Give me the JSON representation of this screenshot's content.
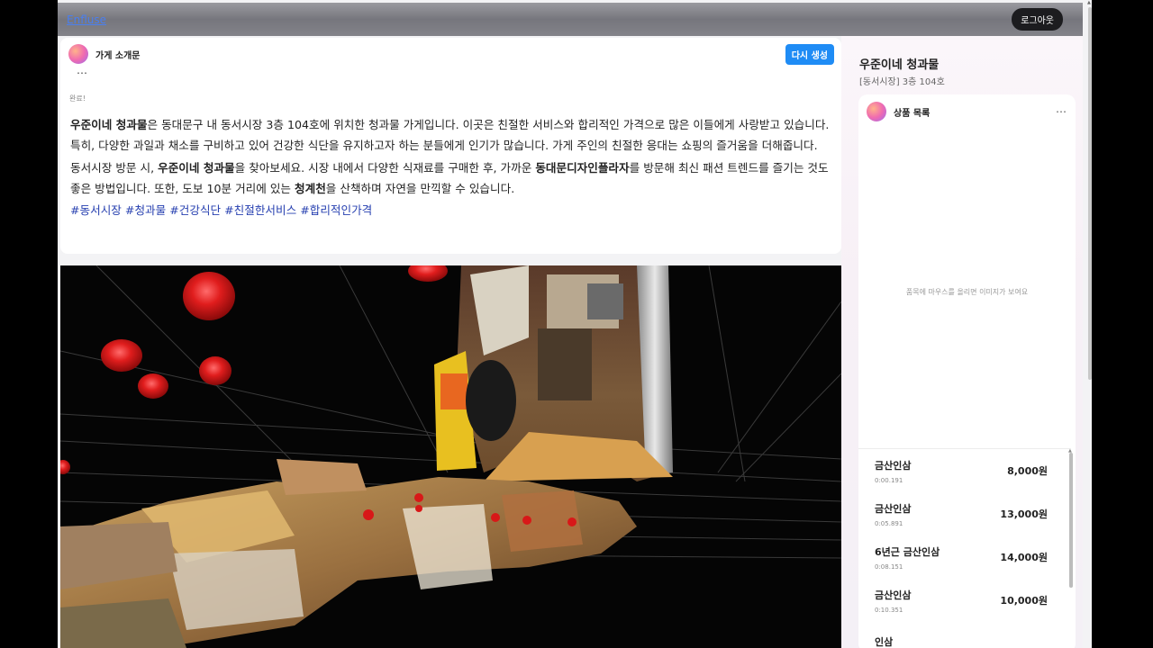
{
  "topbar": {
    "brand": "Enfluse",
    "logout_label": "로그아웃"
  },
  "intro": {
    "title": "가게 소개문",
    "regenerate_label": "다시 생성",
    "more": "⋯",
    "status": "완료!",
    "p1": [
      {
        "text": "우준이네 청과물",
        "bold": true
      },
      {
        "text": "은 동대문구 내 동서시장 3층 104호에 위치한 청과물 가게입니다. 이곳은 친절한 서비스와 합리적인 가격으로 많은 이들에게 사랑받고 있습니다. 특히, 다양한 과일과 채소를 구비하고 있어 건강한 식단을 유지하고자 하는 분들에게 인기가 많습니다. 가게 주인의 친절한 응대는 쇼핑의 즐거움을 더해줍니다.",
        "bold": false
      }
    ],
    "p2": [
      {
        "text": "동서시장 방문 시, ",
        "bold": false
      },
      {
        "text": "우준이네 청과물",
        "bold": true
      },
      {
        "text": "을 찾아보세요. 시장 내에서 다양한 식재료를 구매한 후, 가까운 ",
        "bold": false
      },
      {
        "text": "동대문디자인플라자",
        "bold": true
      },
      {
        "text": "를 방문해 최신 패션 트렌드를 즐기는 것도 좋은 방법입니다. 또한, 도보 10분 거리에 있는 ",
        "bold": false
      },
      {
        "text": "청계천",
        "bold": true
      },
      {
        "text": "을 산책하며 자연을 만끽할 수 있습니다.",
        "bold": false
      }
    ],
    "hashtags": [
      "#동서시장",
      "#청과물",
      "#건강식단",
      "#친절한서비스",
      "#합리적인가격"
    ]
  },
  "viewer": {
    "background": "#050505",
    "grid_color": "#3a3a3a",
    "marker_color": "#d81818"
  },
  "store": {
    "name": "우준이네 청과물",
    "location": "[동서시장] 3층 104호",
    "product_card": {
      "title": "상품 목록",
      "more": "⋯",
      "hint": "품목에 마우스를 올리면 이미지가 보여요",
      "products": [
        {
          "name": "금산인삼",
          "time": "0:00.191",
          "price": "8,000원"
        },
        {
          "name": "금산인삼",
          "time": "0:05.891",
          "price": "13,000원"
        },
        {
          "name": "6년근 금산인삼",
          "time": "0:08.151",
          "price": "14,000원"
        },
        {
          "name": "금산인삼",
          "time": "0:10.351",
          "price": "10,000원"
        },
        {
          "name": "인삼",
          "time": "",
          "price": ""
        }
      ]
    }
  }
}
